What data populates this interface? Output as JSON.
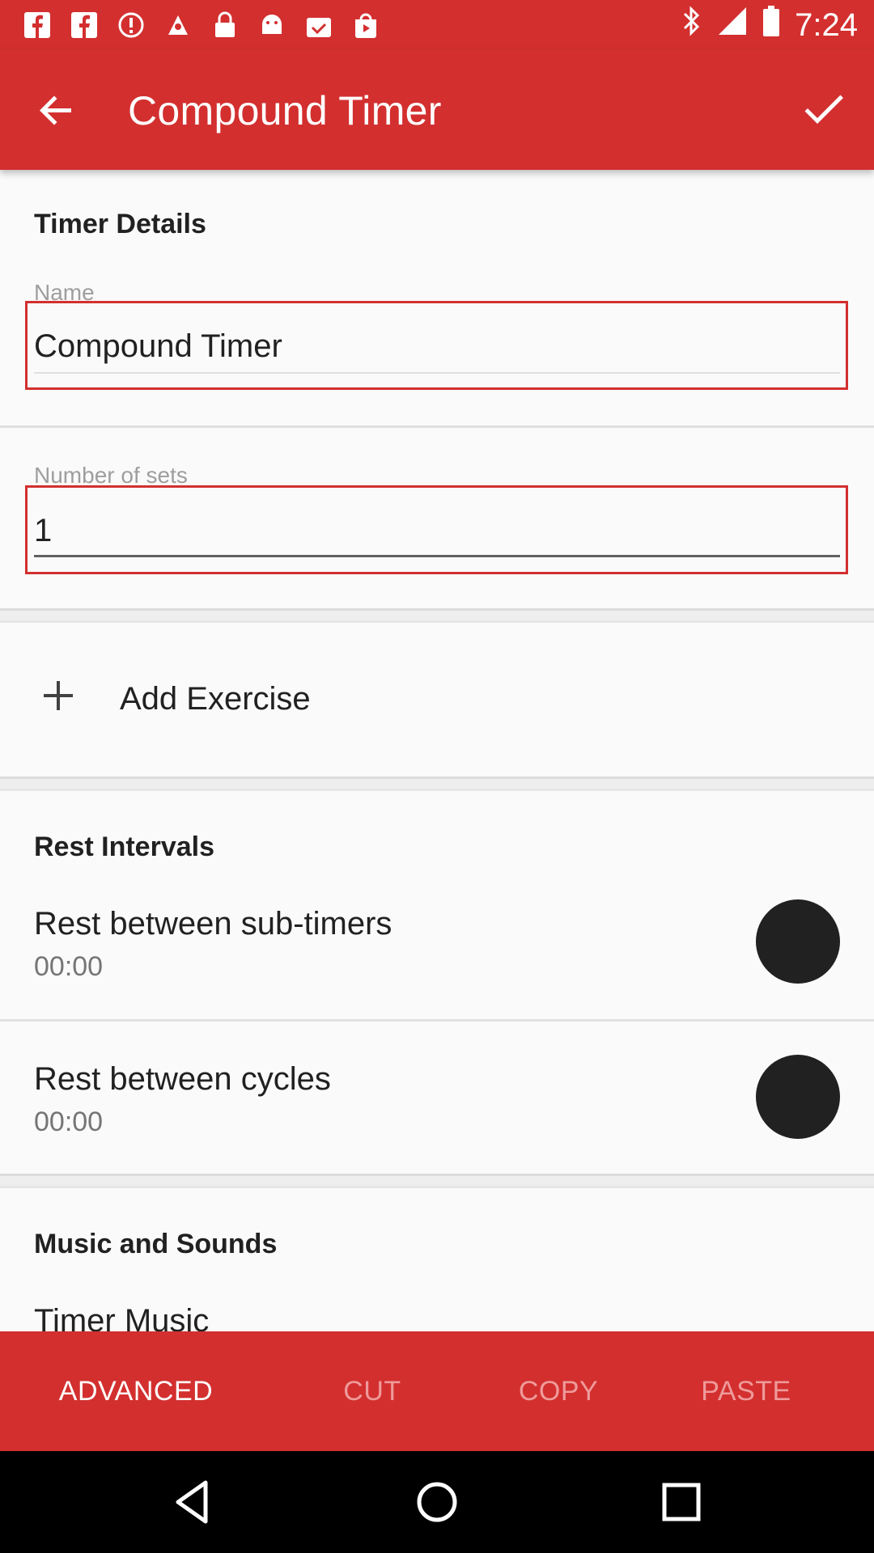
{
  "status_bar": {
    "time": "7:24",
    "icons": [
      "facebook-icon",
      "facebook-icon",
      "alert-icon",
      "fake-gps-icon",
      "lock-icon",
      "android-icon",
      "clipboard-check-icon",
      "play-store-icon",
      "bluetooth-icon",
      "signal-icon",
      "battery-icon"
    ]
  },
  "app_bar": {
    "title": "Compound Timer",
    "back_icon": "back-arrow-icon",
    "confirm_icon": "check-icon"
  },
  "timer_details": {
    "section_title": "Timer Details",
    "name_label": "Name",
    "name_value": "Compound Timer",
    "sets_label": "Number of sets",
    "sets_value": "1"
  },
  "add_exercise": {
    "label": "Add Exercise",
    "icon": "plus-icon"
  },
  "rest_intervals": {
    "section_title": "Rest Intervals",
    "items": [
      {
        "title": "Rest between sub-timers",
        "time": "00:00"
      },
      {
        "title": "Rest between cycles",
        "time": "00:00"
      }
    ]
  },
  "music_sounds": {
    "section_title": "Music and Sounds",
    "timer_music_label": "Timer Music"
  },
  "bottom_bar": {
    "advanced": "ADVANCED",
    "cut": "CUT",
    "copy": "COPY",
    "paste": "PASTE"
  },
  "colors": {
    "primary": "#d32f2f",
    "disabled_text": "#ef9a9a"
  }
}
